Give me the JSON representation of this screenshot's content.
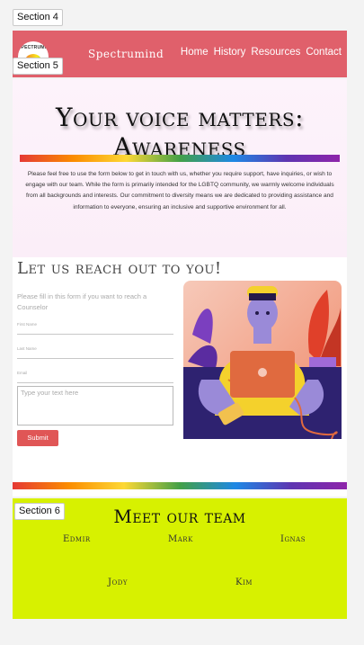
{
  "section_tags": [
    "Section 4",
    "Section 5",
    "Section 6"
  ],
  "header": {
    "logo_text": "SPECTRUMIND",
    "brand": "Spectrumind",
    "nav": [
      "Home",
      "History",
      "Resources",
      "Contact"
    ],
    "background": "#e0606b"
  },
  "awareness": {
    "title": "Your voice matters: Awareness",
    "text": "Please feel free to use the form below to get in touch with us, whether you require support, have inquiries, or wish to engage with our team. While the form is primarily intended for the LGBTQ community, we warmly welcome individuals from all backgrounds and interests. Our commitment to diversity means we are dedicated to providing assistance and information to everyone, ensuring an inclusive and supportive environment for all."
  },
  "contact": {
    "title": "Let us reach out to you!",
    "subtitle": "Please fill in this form if you want to reach a Counselor",
    "fields": [
      "First Name",
      "Last Name",
      "Email"
    ],
    "textarea_placeholder": "Type your text here",
    "submit_label": "Submit",
    "accent": "#e05656"
  },
  "team": {
    "title": "Meet our team",
    "members": [
      "Edmir",
      "Mark",
      "Ignas",
      "Jody",
      "Kim"
    ],
    "background": "#d7f100"
  }
}
